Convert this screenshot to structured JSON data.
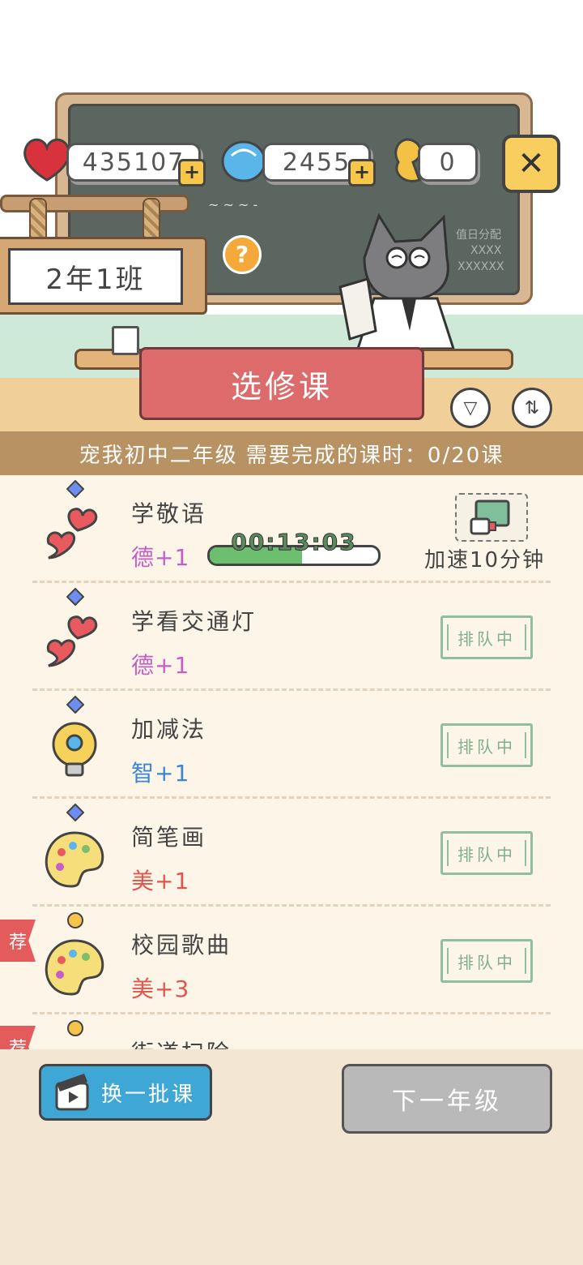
{
  "header": {
    "hearts": "435107",
    "gems": "2455",
    "energy": "0",
    "class_name": "2年1班",
    "board_note_1": "值日分配",
    "board_note_2": "XXXX",
    "board_note_3": "XXXXXX"
  },
  "banner": {
    "title": "选修课"
  },
  "progress_text": "宠我初中二年级 需要完成的课时：0/20课",
  "courses": [
    {
      "title": "学敬语",
      "attr": "德+1",
      "attr_color": "#c55fc6",
      "icon": "heart-icon",
      "status": "timer",
      "timer": "00:13:03",
      "timer_progress": 0.55,
      "speed_label": "加速10分钟"
    },
    {
      "title": "学看交通灯",
      "attr": "德+1",
      "attr_color": "#c55fc6",
      "icon": "heart-icon",
      "status": "排队中"
    },
    {
      "title": "加减法",
      "attr": "智+1",
      "attr_color": "#3a86d4",
      "icon": "lightbulb-icon",
      "status": "排队中"
    },
    {
      "title": "简笔画",
      "attr": "美+1",
      "attr_color": "#e2544e",
      "icon": "palette-icon",
      "status": "排队中"
    },
    {
      "title": "校园歌曲",
      "attr": "美+3",
      "attr_color": "#e2544e",
      "icon": "palette-icon",
      "status": "排队中",
      "recommended": "荐"
    },
    {
      "title": "街道扫除",
      "recommended": "荐"
    }
  ],
  "buttons": {
    "switch_label": "换一批课",
    "next_label": "下一年级"
  },
  "colors": {
    "accent_red": "#dd6b6b",
    "accent_blue": "#3fa7d6",
    "queue_green": "#8fbf9c"
  }
}
